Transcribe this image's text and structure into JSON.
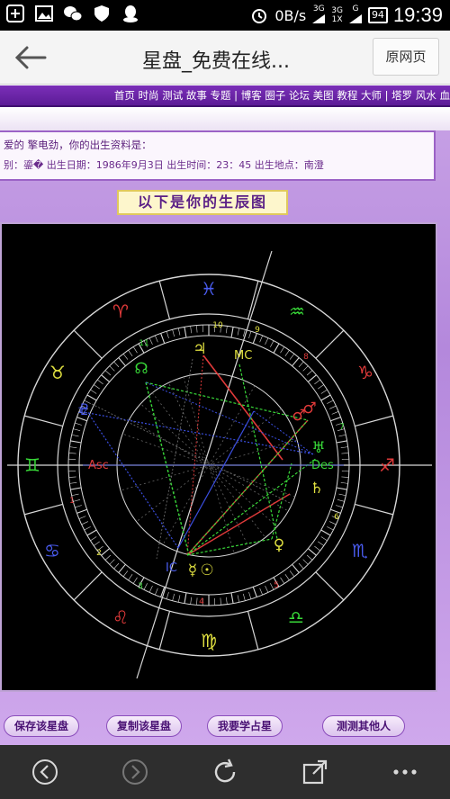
{
  "status_bar": {
    "net_speed": "0B/s",
    "net_type_a": "3G",
    "net_type_b_top": "3G",
    "net_type_b_bottom": "1X",
    "net_type_c": "G",
    "battery": "94",
    "time": "19:39"
  },
  "app_bar": {
    "title": "星盘_免费在线...",
    "original_page_button": "原网页"
  },
  "site_nav": {
    "links_text": "首页 时尚 测试 故事 专题 | 博客 圈子 论坛 美图 教程 大师 | 塔罗 风水 血"
  },
  "info_box": {
    "line1": "爱的 擎电劲，你的出生资料是：",
    "line2": "别：鎏� 出生日期：1986年9月3日 出生时间：23：45 出生地点：南澄"
  },
  "heading": "以下是你的生辰图",
  "chart": {
    "house_numbers": [
      "1",
      "2",
      "3",
      "4",
      "5",
      "6",
      "7",
      "8",
      "9",
      "10",
      "11",
      "12"
    ],
    "angle_labels": [
      "Asc",
      "Des",
      "MC",
      "IC"
    ],
    "colors": {
      "background": "#000000",
      "ring": "#d8d8d8",
      "red": "#e03a3a",
      "green": "#38d838",
      "blue": "#3a4ee0",
      "yellow": "#f0e040",
      "purple": "#b04ce0"
    }
  },
  "buttons": {
    "save": "保存该星盘",
    "copy": "复制该星盘",
    "learn": "我要学占星",
    "test_others": "测测其他人"
  },
  "bottom_nav": {
    "icons": [
      "back-icon",
      "forward-icon",
      "refresh-icon",
      "share-icon",
      "more-icon"
    ]
  }
}
